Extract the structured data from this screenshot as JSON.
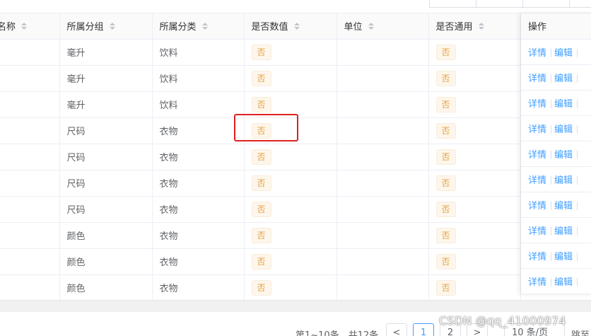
{
  "table": {
    "headers": {
      "name": "名称",
      "group": "所属分组",
      "category": "所属分类",
      "is_numeric": "是否数值",
      "unit": "单位",
      "is_common": "是否通用",
      "actions": "操作"
    },
    "rows": [
      {
        "group": "毫升",
        "category": "饮料",
        "is_numeric": "否",
        "unit": "",
        "is_common": "否"
      },
      {
        "group": "毫升",
        "category": "饮料",
        "is_numeric": "否",
        "unit": "",
        "is_common": "否"
      },
      {
        "group": "毫升",
        "category": "饮料",
        "is_numeric": "否",
        "unit": "",
        "is_common": "否"
      },
      {
        "group": "尺码",
        "category": "衣物",
        "is_numeric": "否",
        "unit": "",
        "is_common": "否"
      },
      {
        "group": "尺码",
        "category": "衣物",
        "is_numeric": "否",
        "unit": "",
        "is_common": "否"
      },
      {
        "group": "尺码",
        "category": "衣物",
        "is_numeric": "否",
        "unit": "",
        "is_common": "否"
      },
      {
        "group": "尺码",
        "category": "衣物",
        "is_numeric": "否",
        "unit": "",
        "is_common": "否"
      },
      {
        "group": "颜色",
        "category": "衣物",
        "is_numeric": "否",
        "unit": "",
        "is_common": "否"
      },
      {
        "group": "颜色",
        "category": "衣物",
        "is_numeric": "否",
        "unit": "",
        "is_common": "否"
      },
      {
        "group": "颜色",
        "category": "衣物",
        "is_numeric": "否",
        "unit": "",
        "is_common": "否"
      }
    ],
    "actions": {
      "detail": "详情",
      "edit": "编辑"
    }
  },
  "pagination": {
    "total_text": "第1~10条，共12条",
    "prev": "<",
    "pages": [
      "1",
      "2"
    ],
    "current_page": "1",
    "next": ">",
    "page_size": "10 条/页",
    "jump": "跳至"
  },
  "watermark": "CSDN @qq_41000974",
  "colors": {
    "link": "#409eff",
    "tag_warning_text": "#e6a23c",
    "tag_warning_bg": "#fdf6ec",
    "highlight": "#e02020"
  }
}
